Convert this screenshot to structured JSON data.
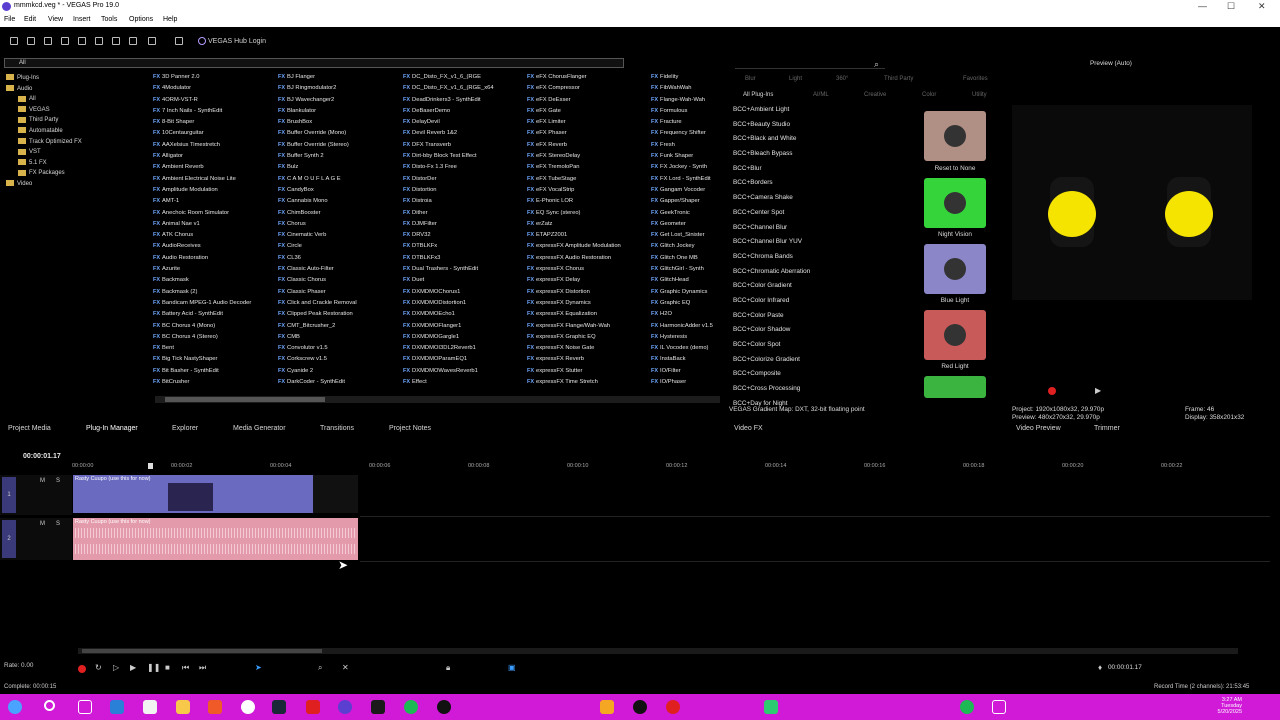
{
  "window": {
    "title": "mmmkcd.veg * - VEGAS Pro 19.0",
    "min": "—",
    "max": "☐",
    "close": "✕"
  },
  "menu": [
    "File",
    "Edit",
    "View",
    "Insert",
    "Tools",
    "Options",
    "Help"
  ],
  "toolbar": {
    "hub_label": "VEGAS Hub Login"
  },
  "plugins": {
    "search_value": "All",
    "tree": [
      "Plug-Ins",
      "Audio",
      "All",
      "VEGAS",
      "Third Party",
      "Automatable",
      "Track Optimized FX",
      "VST",
      "5.1 FX",
      "FX Packages",
      "Video"
    ],
    "columns": [
      [
        "3D Panner 2.0",
        "4Modulator",
        "4ORM-VST-R",
        "7 Inch Nails - SynthEdit",
        "8-Bit Shaper",
        "10Centaurguitar",
        "AAXelsius Timestretch",
        "Alligator",
        "Ambient Reverb",
        "Ambient Electrical Noise Lite",
        "Amplitude Modulation",
        "AMT-1",
        "Anechoic Room Simulator",
        "Animal Nae v1",
        "ATK Chorus",
        "AudioReceives",
        "Audio Restoration",
        "Azurite",
        "Backmask",
        "Backmask (2)",
        "Bandicam MPEG-1 Audio Decoder",
        "Battery Acid - SynthEdit",
        "BC Chorus 4 (Mono)",
        "BC Chorus 4 (Stereo)",
        "Bent",
        "Big Tick NastyShaper",
        "Bit Basher - SynthEdit",
        "BitCrusher"
      ],
      [
        "BJ Flanger",
        "BJ Ringmodulator2",
        "BJ Wavechanger2",
        "Blankulator",
        "BrushBox",
        "Buffer Override (Mono)",
        "Buffer Override (Stereo)",
        "Buffer Synth 2",
        "Bulz",
        "C A M O U F L A G E",
        "CandyBox",
        "Cannabis Mono",
        "ChimBooster",
        "Chorus",
        "Cinematic Verb",
        "Circle",
        "CL36",
        "Classic Auto-Filter",
        "Classic Chorus",
        "Classic Phaser",
        "Click and Crackle Removal",
        "Clipped Peak Restoration",
        "CMT_Bitcrusher_2",
        "CMB",
        "Convolutor v1.5",
        "Corkscrew v1.5",
        "Cyanide 2",
        "DarkCoder - SynthEdit"
      ],
      [
        "DC_Disto_FX_v1_6_(RGE",
        "DC_Disto_FX_v1_6_(RGE_x64",
        "DeadDrinkers3 - SynthEdit",
        "DeBaserDemo",
        "DelayDevil",
        "Devil Reverb 1&2",
        "DFX Transverb",
        "Dirt-bby Block Test Effect",
        "Disto-Fx 1.3 Free",
        "DistorDer",
        "Distortion",
        "Distroia",
        "Dither",
        "DJMFilter",
        "DRV32",
        "DTBLKFx",
        "DTBLKFx3",
        "Dual Trashers - SynthEdit",
        "Duet",
        "DXMDMOChorus1",
        "DXMDMODistortion1",
        "DXMDMOEcho1",
        "DXMDMOFlanger1",
        "DXMDMOGargle1",
        "DXMDMOI3DL2Reverb1",
        "DXMDMOParamEQ1",
        "DXMDMOWavesReverb1",
        "Effect"
      ],
      [
        "eFX ChorusFlanger",
        "eFX Compressor",
        "eFX DeEsser",
        "eFX Gate",
        "eFX Limiter",
        "eFX Phaser",
        "eFX Reverb",
        "eFX StereoDelay",
        "eFX TremoloPan",
        "eFX TubeStage",
        "eFX VocalStrip",
        "E-Phonic LOR",
        "EQ Sync (stereo)",
        "erZatz",
        "ETAPZ2001",
        "expressFX Amplitude Modulation",
        "expressFX Audio Restoration",
        "expressFX Chorus",
        "expressFX Delay",
        "expressFX Distortion",
        "expressFX Dynamics",
        "expressFX Equalization",
        "expressFX Flange/Wah-Wah",
        "expressFX Graphic EQ",
        "expressFX Noise Gate",
        "expressFX Reverb",
        "expressFX Stutter",
        "expressFX Time Stretch"
      ],
      [
        "Fidelity",
        "FibWahWah",
        "Flange-Wah-Wah",
        "Formulous",
        "Fracture",
        "Frequency Shifter",
        "Fresh",
        "Funk Shaper",
        "FX Jockey - Synth",
        "FX Lord - SynthEdit",
        "Gangam Vocoder",
        "Gapper/Shaper",
        "GeekTronic",
        "Geometer",
        "Get Lost_Sinister",
        "Glitch Jockey",
        "Glitch One MB",
        "GlitchGirl - Synth",
        "GlitchHead",
        "Graphic Dynamics",
        "Graphic EQ",
        "H2O",
        "HarmonicAdder v1.5",
        "Hysteresis",
        "IL Vocodex (demo)",
        "InstaBack",
        "IO/Filter",
        "IO/Phaser"
      ]
    ]
  },
  "video_fx": {
    "tabs_row1": [
      "Blur",
      "Light",
      "360°",
      "Third Party",
      "Favorites"
    ],
    "tabs_row2": [
      "All Plug-Ins",
      "AI/ML",
      "Creative",
      "Color",
      "Utility"
    ],
    "list": [
      "BCC+Ambient Light",
      "BCC+Beauty Studio",
      "BCC+Black and White",
      "BCC+Bleach Bypass",
      "BCC+Blur",
      "BCC+Borders",
      "BCC+Camera Shake",
      "BCC+Center Spot",
      "BCC+Channel Blur",
      "BCC+Channel Blur YUV",
      "BCC+Chroma Bands",
      "BCC+Chromatic Aberration",
      "BCC+Color Gradient",
      "BCC+Color Infrared",
      "BCC+Color Paste",
      "BCC+Color Shadow",
      "BCC+Color Spot",
      "BCC+Colorize Gradient",
      "BCC+Composite",
      "BCC+Cross Processing",
      "BCC+Day for Night"
    ],
    "presets": [
      {
        "label": "Reset to None",
        "color": "#b08f84"
      },
      {
        "label": "Night Vision",
        "color": "#34d43a"
      },
      {
        "label": "Blue Light",
        "color": "#8a86c8"
      },
      {
        "label": "Red Light",
        "color": "#c85a5a"
      }
    ],
    "status": "VEGAS Gradient Map: DXT, 32-bit floating point"
  },
  "preview": {
    "mode": "Preview (Auto)",
    "project": "Project:  1920x1080x32, 29.970p",
    "preview_line": "Preview:  480x270x32, 29.970p",
    "frame": "Frame:   46",
    "display": "Display:  358x201x32"
  },
  "panel_tabs": [
    "Project Media",
    "Plug-In Manager",
    "Explorer",
    "Media Generator",
    "Transitions",
    "Project Notes",
    "Video FX",
    "Video Preview",
    "Trimmer"
  ],
  "timeline": {
    "timecode": "00:00:01.17",
    "ruler": [
      "00:00:00",
      "00:00:02",
      "00:00:04",
      "00:00:06",
      "00:00:08",
      "00:00:10",
      "00:00:12",
      "00:00:14",
      "00:00:16",
      "00:00:18",
      "00:00:20",
      "00:00:22"
    ],
    "video_clip_label": "Rasty Cuupo (use this for now)",
    "audio_clip_label": "Rasty Cuupo (use this for now)",
    "track1": "1",
    "track2": "2"
  },
  "transport": {
    "rate": "Rate: 0.00",
    "timecode": "00:00:01.17"
  },
  "status": {
    "left": "Complete: 00:00:15",
    "right": "Record Time (2 channels): 21:53:45"
  },
  "taskbar": {
    "time": "3:27 AM",
    "day": "Tuesday",
    "date": "5/20/2025"
  }
}
